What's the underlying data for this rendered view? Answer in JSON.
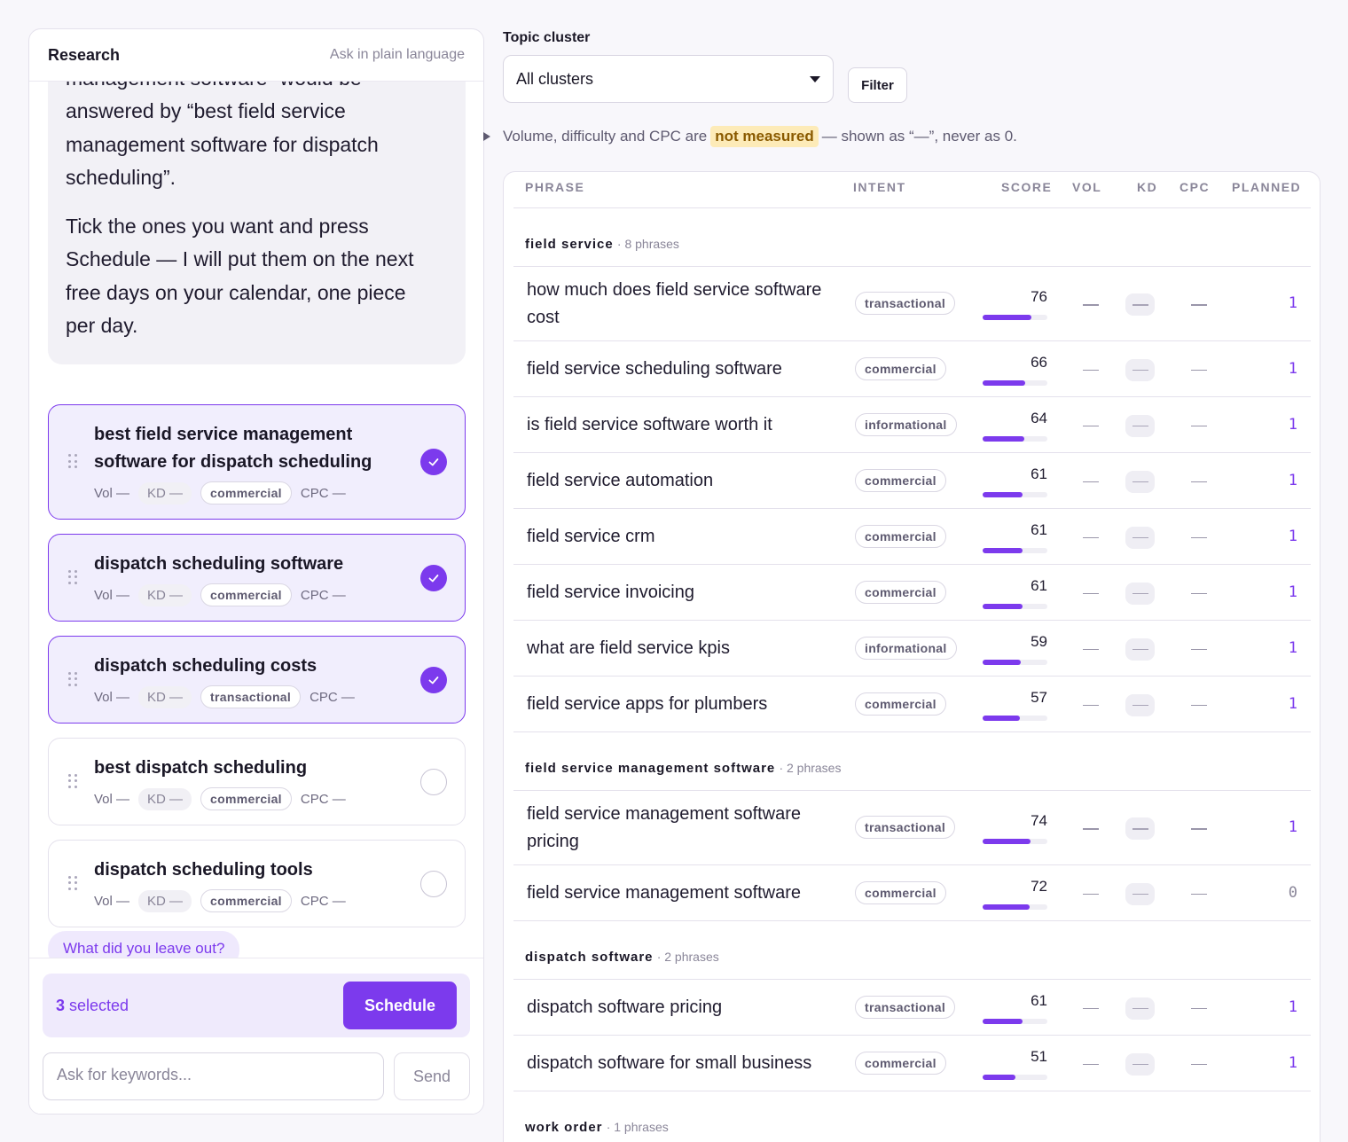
{
  "research": {
    "title": "Research",
    "hint": "Ask in plain language",
    "message_lines_p1": [
      "management software” would be",
      "answered by “best field service",
      "management software for dispatch",
      "scheduling”."
    ],
    "message_p2_lines": [
      "Tick the ones you want and press",
      "Schedule — I will put them on the next",
      "free days on your calendar, one piece",
      "per day."
    ],
    "cards": [
      {
        "title": "best field service management software for dispatch scheduling",
        "vol": "Vol —",
        "kd": "KD —",
        "intent": "commercial",
        "cpc": "CPC —",
        "selected": true
      },
      {
        "title": "dispatch scheduling software",
        "vol": "Vol —",
        "kd": "KD —",
        "intent": "commercial",
        "cpc": "CPC —",
        "selected": true
      },
      {
        "title": "dispatch scheduling costs",
        "vol": "Vol —",
        "kd": "KD —",
        "intent": "transactional",
        "cpc": "CPC —",
        "selected": true
      },
      {
        "title": "best dispatch scheduling",
        "vol": "Vol —",
        "kd": "KD —",
        "intent": "commercial",
        "cpc": "CPC —",
        "selected": false
      },
      {
        "title": "dispatch scheduling tools",
        "vol": "Vol —",
        "kd": "KD —",
        "intent": "commercial",
        "cpc": "CPC —",
        "selected": false
      }
    ],
    "leave_out": "What did you leave out?",
    "selected_count": "3",
    "selected_label": " selected",
    "schedule_label": "Schedule",
    "input_placeholder": "Ask for keywords...",
    "send_label": "Send"
  },
  "filters": {
    "label": "Topic cluster",
    "cluster_value": "All clusters",
    "filter_button": "Filter"
  },
  "notice": {
    "before": "Volume, difficulty and CPC are",
    "highlight": "not measured",
    "after": "— shown as “—”, never as 0."
  },
  "table": {
    "headers": {
      "phrase": "PHRASE",
      "intent": "INTENT",
      "score": "SCORE",
      "vol": "VOL",
      "kd": "KD",
      "cpc": "CPC",
      "planned": "PLANNED"
    },
    "groups": [
      {
        "name": "field service",
        "count": "· 8 phrases",
        "rows": [
          {
            "phrase": "how much does field service software cost",
            "intent": "transactional",
            "score": 76,
            "planned": "1"
          },
          {
            "phrase": "field service scheduling software",
            "intent": "commercial",
            "score": 66,
            "planned": "1"
          },
          {
            "phrase": "is field service software worth it",
            "intent": "informational",
            "score": 64,
            "planned": "1"
          },
          {
            "phrase": "field service automation",
            "intent": "commercial",
            "score": 61,
            "planned": "1"
          },
          {
            "phrase": "field service crm",
            "intent": "commercial",
            "score": 61,
            "planned": "1"
          },
          {
            "phrase": "field service invoicing",
            "intent": "commercial",
            "score": 61,
            "planned": "1"
          },
          {
            "phrase": "what are field service kpis",
            "intent": "informational",
            "score": 59,
            "planned": "1"
          },
          {
            "phrase": "field service apps for plumbers",
            "intent": "commercial",
            "score": 57,
            "planned": "1"
          }
        ]
      },
      {
        "name": "field service management software",
        "count": "· 2 phrases",
        "rows": [
          {
            "phrase": "field service management software pricing",
            "intent": "transactional",
            "score": 74,
            "planned": "1"
          },
          {
            "phrase": "field service management software",
            "intent": "commercial",
            "score": 72,
            "planned": "0"
          }
        ]
      },
      {
        "name": "dispatch software",
        "count": "· 2 phrases",
        "rows": [
          {
            "phrase": "dispatch software pricing",
            "intent": "transactional",
            "score": 61,
            "planned": "1"
          },
          {
            "phrase": "dispatch software for small business",
            "intent": "commercial",
            "score": 51,
            "planned": "1"
          }
        ]
      },
      {
        "name": "work order",
        "count": "· 1 phrases",
        "rows": []
      }
    ]
  },
  "colors": {
    "accent": "#7c3aed",
    "highlight_bg": "#fdebb8"
  }
}
